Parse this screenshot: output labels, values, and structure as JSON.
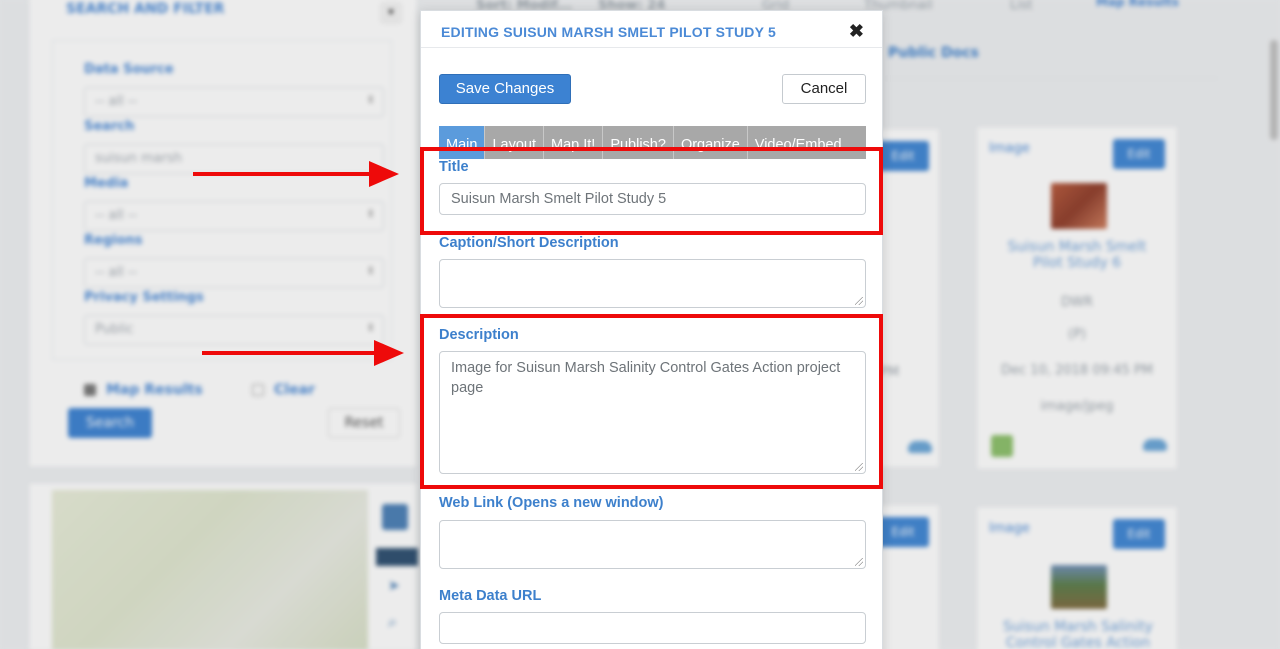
{
  "background": {
    "search_title": "SEARCH AND FILTER",
    "fields": [
      {
        "label": "Data Source",
        "value": "-- all --"
      },
      {
        "label": "Search",
        "value": "suisun marsh"
      },
      {
        "label": "Media",
        "value": "-- all --"
      },
      {
        "label": "Regions",
        "value": "-- all --"
      },
      {
        "label": "Privacy Settings",
        "value": "Public"
      }
    ],
    "map_results": "Map Results",
    "clear": "Clear",
    "search_btn": "Search",
    "reset_btn": "Reset",
    "top_bar": [
      "Sort: Modif...",
      "Show: 24",
      "Grid",
      "Thumbnail",
      "List",
      "Map Results"
    ],
    "tab_public": "Public Docs",
    "card1": {
      "type": "Image",
      "edit": "Edit",
      "title": "Suisun Marsh Smelt Pilot Study 6",
      "source": "DWR",
      "id": "(P)",
      "date": "Dec 10, 2018 09:45 PM",
      "mime": "image/jpeg"
    },
    "card2": {
      "type": "Image",
      "edit": "Edit",
      "title": "Suisun Marsh Salinity Control Gates Action"
    },
    "partial_left": {
      "edit": "Edit",
      "date": "PM"
    }
  },
  "modal": {
    "title": "EDITING SUISUN MARSH SMELT PILOT STUDY 5",
    "save_label": "Save Changes",
    "cancel_label": "Cancel",
    "tabs": [
      "Main",
      "Layout",
      "Map It!",
      "Publish?",
      "Organize",
      "Video/Embed"
    ],
    "fields": {
      "title_label": "Title",
      "title_value": "Suisun Marsh Smelt Pilot Study 5",
      "caption_label": "Caption/Short Description",
      "caption_value": "",
      "description_label": "Description",
      "description_value": "Image for Suisun Marsh Salinity Control Gates Action project page",
      "weblink_label": "Web Link (Opens a new window)",
      "weblink_value": "",
      "metadata_label": "Meta Data URL",
      "metadata_value": ""
    }
  },
  "colors": {
    "accent": "#3c82d2",
    "annotation_red": "#ee0a0a",
    "tab_active": "#5b9bdc",
    "tab_bg": "#a8a8a8"
  }
}
